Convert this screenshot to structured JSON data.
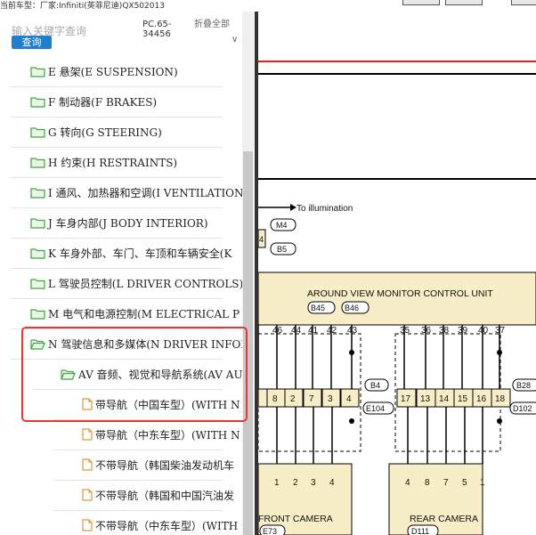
{
  "topbar": {
    "car_model": "当前车型：厂家:Infiniti(英菲尼迪)QX502013"
  },
  "sidebar": {
    "search_placeholder": "输入关键字查询",
    "query_button": "查询",
    "pc_code": "PC.65-34456",
    "collapse_label": "折叠全部",
    "collapse_arrow": "∨",
    "items": [
      {
        "label": "E 悬架(E SUSPENSION)",
        "icon": "folder-icon"
      },
      {
        "label": "F 制动器(F BRAKES)",
        "icon": "folder-icon"
      },
      {
        "label": "G 转向(G STEERING)",
        "icon": "folder-icon"
      },
      {
        "label": "H 约束(H RESTRAINTS)",
        "icon": "folder-icon"
      },
      {
        "label": "I 通风、加热器和空调(I VENTILATION",
        "icon": "folder-icon"
      },
      {
        "label": "J 车身内部(J BODY INTERIOR)",
        "icon": "folder-icon"
      },
      {
        "label": "K 车身外部、车门、车顶和车辆安全(K",
        "icon": "folder-icon"
      },
      {
        "label": "L 驾驶员控制(L DRIVER CONTROLS)",
        "icon": "folder-icon"
      },
      {
        "label": "M 电气和电源控制(M ELECTRICAL P",
        "icon": "folder-icon"
      },
      {
        "label": "N 驾驶信息和多媒体(N DRIVER INFOR",
        "icon": "folder-open-icon"
      },
      {
        "label": "AV 音频、视觉和导航系统(AV AU",
        "icon": "folder-open-icon"
      },
      {
        "label": "带导航（中国车型）(WITH N",
        "icon": "document-icon"
      },
      {
        "label": "带导航（中东车型）(WITH N",
        "icon": "document-icon"
      },
      {
        "label": "不带导航（韩国柴油发动机车",
        "icon": "document-icon"
      },
      {
        "label": "不带导航（韩国和中国汽油发",
        "icon": "document-icon"
      },
      {
        "label": "不带导航（中东车型）(WITH",
        "icon": "document-icon"
      }
    ]
  },
  "diagram": {
    "to_illumination": "To illumination",
    "tag_m4": "M4",
    "tag_b5": "B5",
    "left_edge_num": "4",
    "unit_title": "AROUND VIEW MONITOR CONTROL UNIT",
    "unit_conn_1": "B45",
    "unit_conn_2": "B46",
    "pins_left_top": [
      "5",
      "46",
      "44",
      "41",
      "42",
      "43"
    ],
    "pins_right_top": [
      "35",
      "36",
      "38",
      "39",
      "40",
      "37"
    ],
    "conn_left_cells": [
      "8",
      "2",
      "7",
      "3",
      "4"
    ],
    "conn_right_cells": [
      "17",
      "13",
      "14",
      "15",
      "16",
      "18"
    ],
    "b4": "B4",
    "e104": "E104",
    "b28": "B28",
    "d102": "D102",
    "front_pins": [
      "1",
      "2",
      "3",
      "4"
    ],
    "rear_pins": [
      "4",
      "8",
      "7",
      "5",
      "1"
    ],
    "front_camera": "FRONT CAMERA",
    "rear_camera": "REAR CAMERA",
    "e73": "E73",
    "d111": "D111"
  },
  "colors": {
    "accent_button": "#1e7fd0",
    "highlight_border": "#e33333",
    "folder_icon": "#3fa63f",
    "document_icon": "#e09a3c",
    "module_fill": "#f7edc6",
    "red_line": "#e02020"
  }
}
